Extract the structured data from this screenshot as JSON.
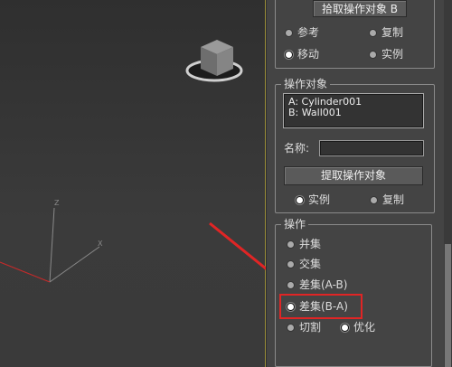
{
  "viewport": {
    "gizmo_label": "view-cube",
    "axis_labels": {
      "z": "Z",
      "x": "X"
    }
  },
  "pick_panel": {
    "pick_button_label": "拾取操作对象 B",
    "options": [
      {
        "label": "参考",
        "selected": false
      },
      {
        "label": "复制",
        "selected": false
      },
      {
        "label": "移动",
        "selected": true
      },
      {
        "label": "实例",
        "selected": false
      }
    ]
  },
  "operands": {
    "title": "操作对象",
    "items": [
      "A: Cylinder001",
      "B: Wall001"
    ],
    "name_label": "名称:",
    "name_value": "",
    "extract_button_label": "提取操作对象",
    "extract_options": [
      {
        "label": "实例",
        "selected": true
      },
      {
        "label": "复制",
        "selected": false
      }
    ]
  },
  "operation": {
    "title": "操作",
    "options": [
      {
        "label": "并集",
        "selected": false
      },
      {
        "label": "交集",
        "selected": false
      },
      {
        "label": "差集(A-B)",
        "selected": false
      },
      {
        "label": "差集(B-A)",
        "selected": true
      }
    ],
    "cut_label": "切割",
    "cut_selected": false,
    "optimize_label": "优化",
    "optimize_selected": true
  },
  "colors": {
    "annotation_red": "#e02525",
    "panel_bg": "#444444",
    "viewport_border": "#9a8d39"
  }
}
